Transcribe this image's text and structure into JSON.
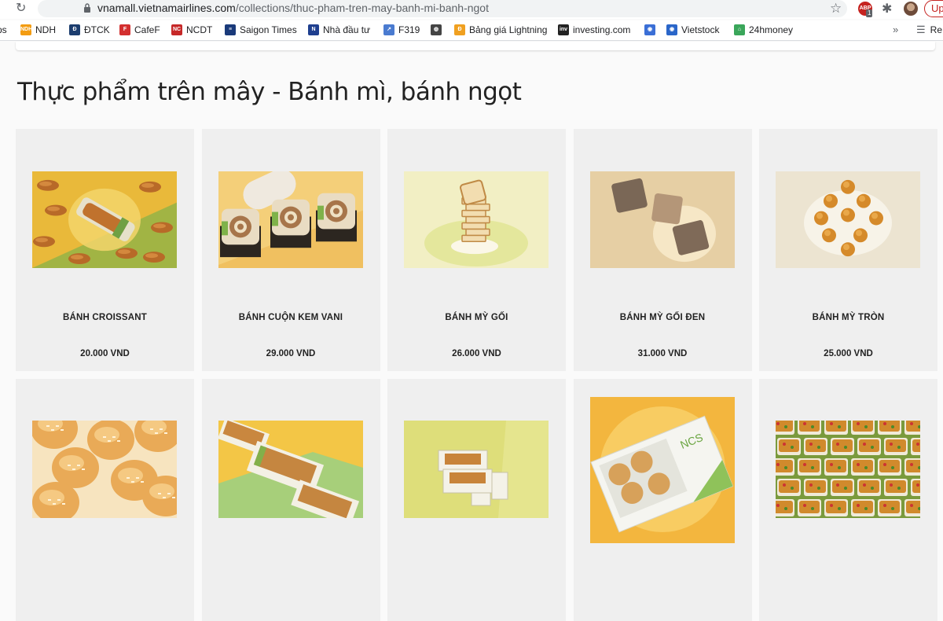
{
  "browser": {
    "url_host": "vnamall.vietnamairlines.com",
    "url_path": "/collections/thuc-pham-tren-may-banh-mi-banh-ngot",
    "abp_count": "1",
    "abp_label": "ABP",
    "update_label": "Up"
  },
  "bookmarks": [
    {
      "label": "ps"
    },
    {
      "label": "NDH",
      "icon": "ndh-icon",
      "color": "#f39c12",
      "glyph": "NDH"
    },
    {
      "label": "ĐTCK",
      "icon": "dtck-icon",
      "color": "#1c3d6e",
      "glyph": "Đ"
    },
    {
      "label": "CafeF",
      "icon": "cafef-icon",
      "color": "#d32f2f",
      "glyph": "F"
    },
    {
      "label": "NCDT",
      "icon": "ncdt-icon",
      "color": "#c62828",
      "glyph": "NC"
    },
    {
      "label": "Saigon Times",
      "icon": "saigon-times-icon",
      "color": "#1a3a7a",
      "glyph": "≡"
    },
    {
      "label": "Nhà đầu tư",
      "icon": "nhadautu-icon",
      "color": "#1f3f8f",
      "glyph": "N"
    },
    {
      "label": "F319",
      "icon": "f319-icon",
      "color": "#4a7bd0",
      "glyph": "↗"
    },
    {
      "label": "",
      "icon": "globe-icon",
      "color": "#444444",
      "glyph": "◍"
    },
    {
      "label": "Bảng giá Lightning",
      "icon": "lightning-icon",
      "color": "#f0a020",
      "glyph": "Đ"
    },
    {
      "label": "investing.com",
      "icon": "investing-icon",
      "color": "#222222",
      "glyph": "inv"
    },
    {
      "label": "",
      "icon": "circle-logo-icon",
      "color": "#3b6fd6",
      "glyph": "◉"
    },
    {
      "label": "Vietstock",
      "icon": "vietstock-icon",
      "color": "#2a66c9",
      "glyph": "◉"
    },
    {
      "label": "24hmoney",
      "icon": "24hmoney-icon",
      "color": "#3aa65a",
      "glyph": "⌂"
    }
  ],
  "reading_list_label": "Re",
  "page": {
    "title": "Thực phẩm trên mây - Bánh mì, bánh ngọt"
  },
  "products": [
    {
      "name": "BÁNH CROISSANT",
      "price": "20.000 VND",
      "scene": "croissant"
    },
    {
      "name": "BÁNH CUỘN KEM VANI",
      "price": "29.000 VND",
      "scene": "roll"
    },
    {
      "name": "BÁNH MỲ GỐI",
      "price": "26.000 VND",
      "scene": "toast"
    },
    {
      "name": "BÁNH MỲ GỐI ĐEN",
      "price": "31.000 VND",
      "scene": "darktoast"
    },
    {
      "name": "BÁNH MỲ TRÒN",
      "price": "25.000 VND",
      "scene": "buns"
    },
    {
      "name": "",
      "price": "",
      "scene": "sweetbuns"
    },
    {
      "name": "",
      "price": "",
      "scene": "boxedcake"
    },
    {
      "name": "",
      "price": "",
      "scene": "boxes"
    },
    {
      "name": "",
      "price": "",
      "scene": "muffinbox"
    },
    {
      "name": "",
      "price": "",
      "scene": "pizzabread"
    }
  ]
}
